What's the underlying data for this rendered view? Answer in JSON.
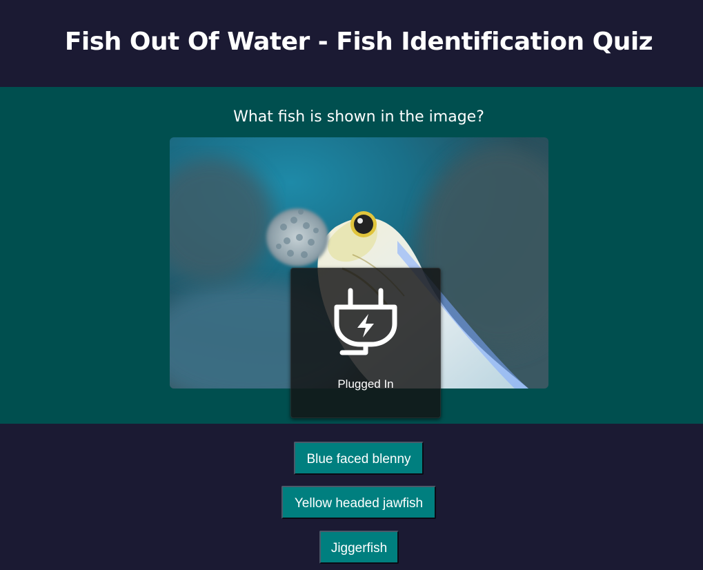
{
  "page": {
    "title": "Fish Out Of Water - Fish Identification Quiz"
  },
  "quiz": {
    "question": "What fish is shown in the image?",
    "image_icon": "fish-photo",
    "answers": [
      {
        "label": "Blue faced blenny"
      },
      {
        "label": "Yellow headed jawfish"
      },
      {
        "label": "Jiggerfish"
      }
    ]
  },
  "notification": {
    "icon": "plug-charging-icon",
    "label": "Plugged In"
  },
  "colors": {
    "header_bg": "#1b1a33",
    "quiz_panel_bg": "#004f4f",
    "answer_button_bg": "#007f7f",
    "text": "#ffffff"
  }
}
